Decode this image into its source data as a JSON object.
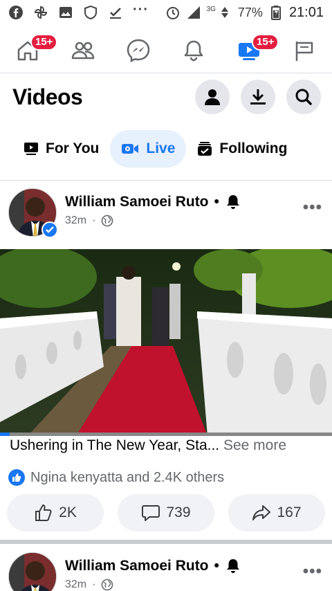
{
  "status_bar": {
    "battery": "77%",
    "network": "3G",
    "time": "21:01",
    "left_icons": [
      "facebook-icon",
      "pinwheel-icon",
      "gallery-icon",
      "shield-icon",
      "checkmark-icon",
      "more-dots-icon"
    ]
  },
  "top_nav": {
    "tabs": [
      {
        "name": "home",
        "badge": "15+"
      },
      {
        "name": "friends",
        "badge": ""
      },
      {
        "name": "messenger",
        "badge": ""
      },
      {
        "name": "notifications",
        "badge": ""
      },
      {
        "name": "watch",
        "badge": "15+",
        "active": true
      },
      {
        "name": "pages",
        "badge": ""
      }
    ]
  },
  "header": {
    "title": "Videos"
  },
  "chips": [
    {
      "label": "For You",
      "icon": "play-icon",
      "active": false
    },
    {
      "label": "Live",
      "icon": "live-camera-icon",
      "active": true
    },
    {
      "label": "Following",
      "icon": "following-icon",
      "active": false
    }
  ],
  "posts": [
    {
      "author": "William Samoei Ruto",
      "time": "32m",
      "caption": "Ushering in The New Year, Sta...",
      "see_more": "See more",
      "reactions_text": "Ngina kenyatta and 2.4K others",
      "likes": "2K",
      "comments": "739",
      "shares": "167",
      "video_progress": 0.03
    },
    {
      "author": "William Samoei Ruto",
      "time": "32m"
    }
  ],
  "colors": {
    "accent": "#1877f2",
    "badge": "#e41e3f",
    "chip_active_bg": "#e7f0fd",
    "button_bg": "#f0f2f5"
  }
}
